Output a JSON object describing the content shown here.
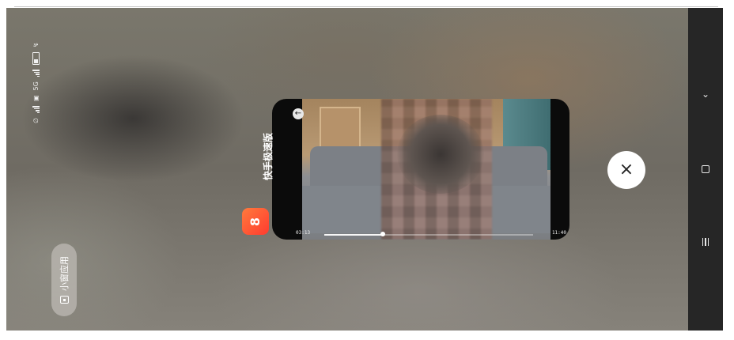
{
  "status_bar": {
    "network": "5G",
    "icons": [
      "mute-icon",
      "signal-icon",
      "wifi-icon",
      "signal-5g-icon",
      "battery-icon",
      "charging-icon"
    ]
  },
  "floating_app": {
    "label": "快手极速版",
    "icon_text": "8",
    "icon_color": "#ff4a2f",
    "video": {
      "elapsed": "03:13",
      "duration": "11:40",
      "progress_fraction": 0.28
    }
  },
  "mini_window": {
    "label": "小窗应用",
    "icon": "small-window-icon"
  },
  "controls": {
    "close": "×",
    "back": "←"
  },
  "nav_bar": {
    "items": [
      "chevron-down-icon",
      "home-icon",
      "recents-icon"
    ],
    "chevron": "⌄"
  }
}
